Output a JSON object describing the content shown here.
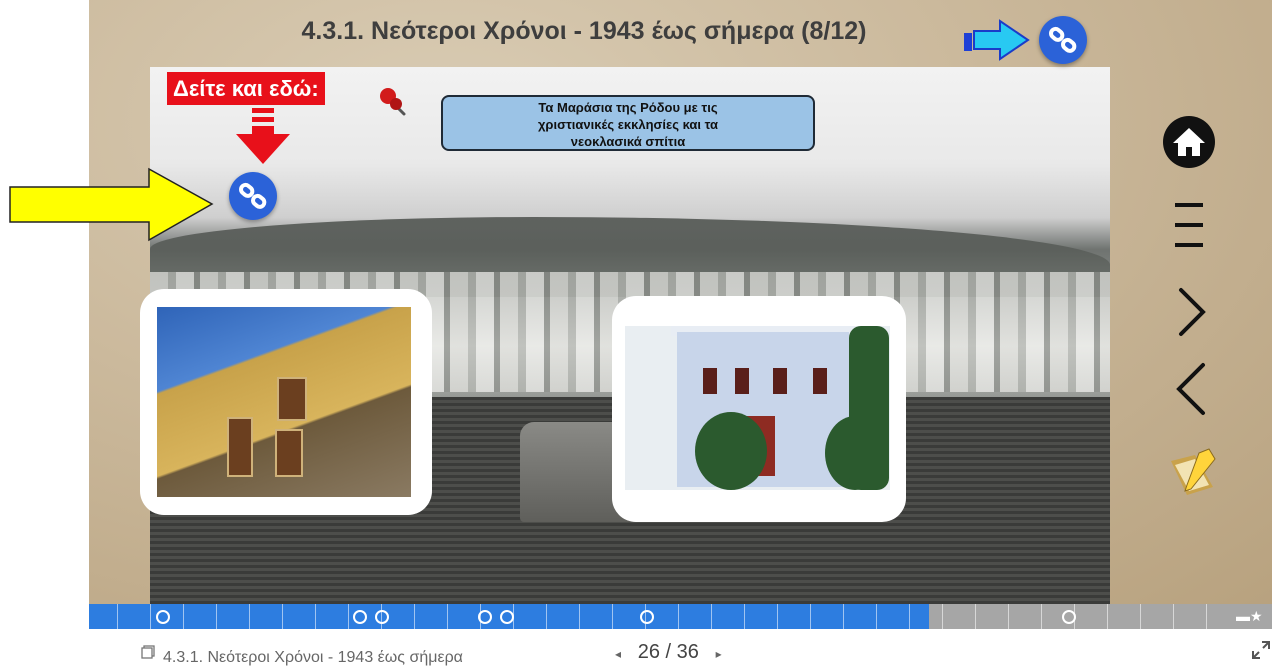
{
  "slide": {
    "title": "4.3.1. Νεότεροι Χρόνοι - 1943 έως σήμερα (8/12)",
    "see_also_label": "Δείτε και εδώ:",
    "callout_lines": [
      "Τα Μαράσια της Ρόδου με τις",
      "χριστιανικές εκκλησίες και τα",
      "νεοκλασικά σπίτια"
    ]
  },
  "icons": {
    "link_top": "link-icon",
    "link_left": "link-icon",
    "home": "home-icon",
    "menu": "menu-icon",
    "next": "chevron-right-icon",
    "prev": "chevron-left-icon",
    "notes": "notebook-icon",
    "pin": "pushpin-icon",
    "fullscreen": "expand-icon",
    "doc": "document-icon"
  },
  "progress": {
    "current_fraction": 0.71
  },
  "footer": {
    "title": "4.3.1. Νεότεροι Χρόνοι - 1943 έως σήμερα",
    "current_page": "26",
    "separator": "/",
    "total_pages": "36",
    "prev_symbol": "◂",
    "next_symbol": "▸"
  },
  "colors": {
    "accent": "#2b62d8",
    "progress_fill": "#2d7de0",
    "see_also_bg": "#e8101a",
    "callout_bg": "#9bc3e6",
    "arrow_yellow": "#ffff00"
  }
}
